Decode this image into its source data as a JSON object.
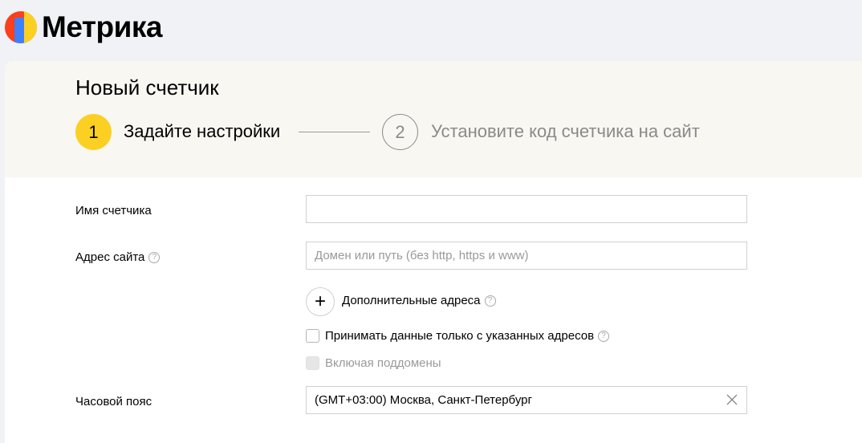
{
  "header": {
    "logo_text": "Метрика",
    "logo_colors": [
      "#fc3f1d",
      "#3f7ff9",
      "#fcd022"
    ]
  },
  "page": {
    "title": "Новый счетчик"
  },
  "steps": [
    {
      "number": "1",
      "label": "Задайте настройки",
      "state": "active",
      "color": "#fcd022"
    },
    {
      "number": "2",
      "label": "Установите код счетчика на сайт",
      "state": "inactive"
    }
  ],
  "form": {
    "counter_name": {
      "label": "Имя счетчика",
      "value": "",
      "placeholder": ""
    },
    "site_address": {
      "label": "Адрес сайта",
      "value": "",
      "placeholder": "Домен или путь (без http, https и www)",
      "help_icon": "question-icon"
    },
    "additional_addresses": {
      "label": "Дополнительные адреса",
      "icon": "plus-icon",
      "help_icon": "question-icon"
    },
    "accept_only_listed": {
      "label": "Принимать данные только с указанных адресов",
      "checked": false,
      "help_icon": "question-icon"
    },
    "include_subdomains": {
      "label": "Включая поддомены",
      "checked": false,
      "disabled": true
    },
    "timezone": {
      "label": "Часовой пояс",
      "value": "(GMT+03:00) Москва, Санкт-Петербург",
      "clear_icon": "close-icon"
    },
    "help_glyph": "?",
    "plus_glyph": "+"
  }
}
